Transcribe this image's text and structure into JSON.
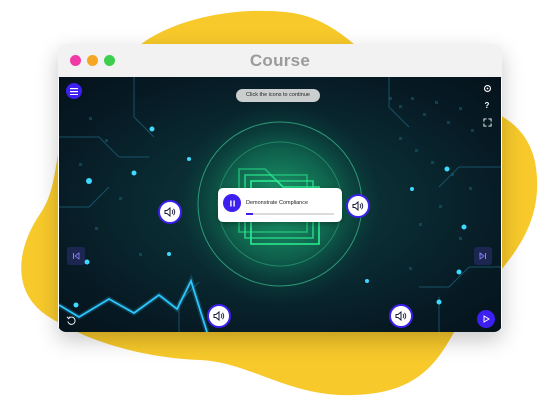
{
  "window": {
    "title": "Course"
  },
  "stage": {
    "instruction": "Click the icons to continue",
    "progress_card": {
      "label": "Demonstrate Compliance",
      "progress": 0.08
    },
    "audio_buttons": [
      "speaker-icon",
      "speaker-icon",
      "speaker-icon",
      "speaker-icon"
    ],
    "controls": {
      "menu_icon": "hamburger-icon",
      "settings_icon": "gear-icon",
      "help_icon": "question-icon",
      "fullscreen_icon": "expand-icon",
      "prev_icon": "skip-back-icon",
      "next_icon": "skip-forward-icon",
      "replay_icon": "replay-icon",
      "play_icon": "play-icon"
    }
  },
  "colors": {
    "accent": "#3d1ff0",
    "blob": "#f7c92b",
    "glow": "#27f29a",
    "cyan_node": "#3fd8ff"
  }
}
